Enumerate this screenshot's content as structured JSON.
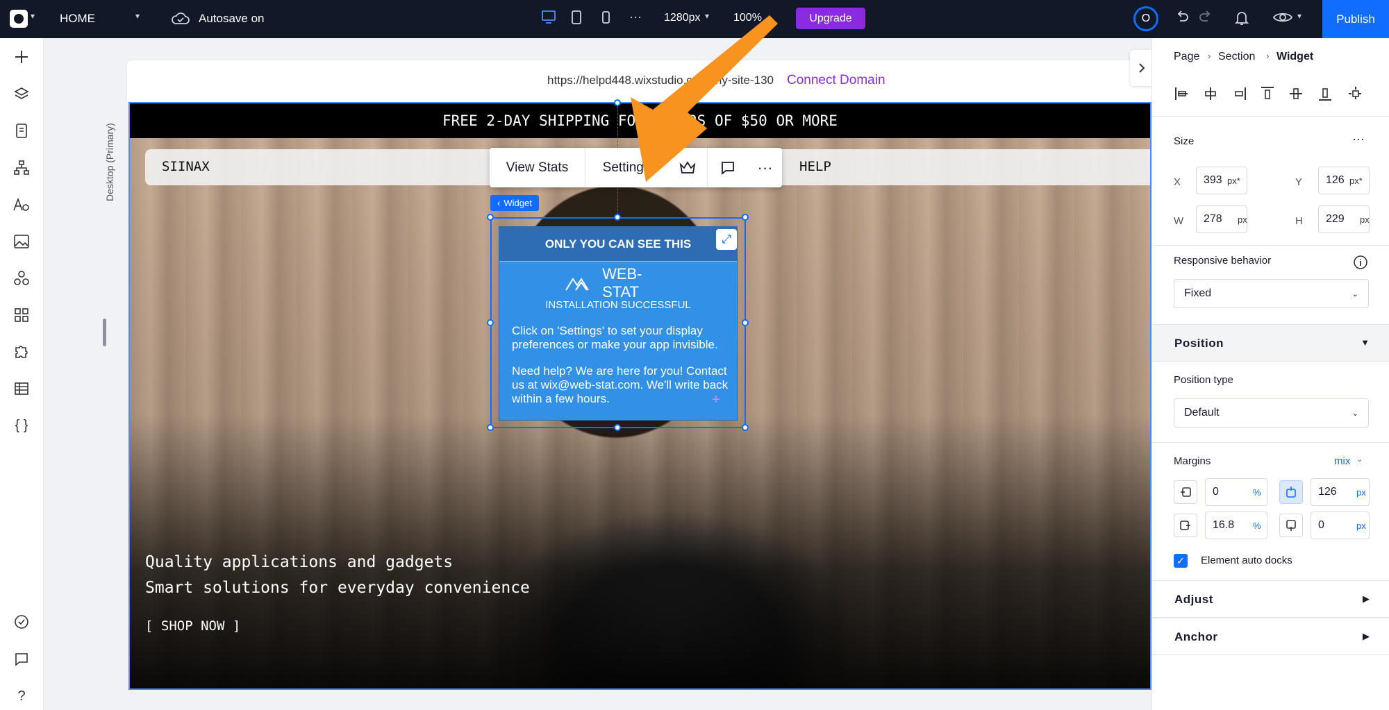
{
  "topbar": {
    "page_name": "HOME",
    "autosave": "Autosave on",
    "width_value": "1280px",
    "zoom": "100%",
    "upgrade": "Upgrade",
    "publish": "Publish",
    "avatar_letter": "O"
  },
  "canvas": {
    "url": "https://helpd448.wixstudio.com/my-site-130",
    "connect_domain": "Connect Domain",
    "breakpoint_label": "Desktop (Primary)"
  },
  "site": {
    "promo": "FREE 2-DAY SHIPPING FOR ORDERS OF $50 OR MORE",
    "brand": "SIINAX",
    "help": "HELP",
    "hero_line1": "Quality applications and gadgets",
    "hero_line2": "Smart solutions for everyday convenience",
    "cta": "[ SHOP NOW ]"
  },
  "context_toolbar": {
    "view_stats": "View Stats",
    "settings": "Settings"
  },
  "widget": {
    "tag": "Widget",
    "header": "ONLY YOU CAN SEE THIS",
    "logo_text": "WEB-STAT",
    "success": "INSTALLATION SUCCESSFUL",
    "para1": "Click on 'Settings' to set your display preferences or make your app invisible.",
    "para2": "Need help? We are here for you! Contact us at wix@web-stat.com. We'll write back within a few hours."
  },
  "inspector": {
    "breadcrumb": {
      "page": "Page",
      "section": "Section",
      "widget": "Widget"
    },
    "size_title": "Size",
    "x_label": "X",
    "x_value": "393",
    "x_unit": "px*",
    "y_label": "Y",
    "y_value": "126",
    "y_unit": "px*",
    "w_label": "W",
    "w_value": "278",
    "w_unit": "px",
    "h_label": "H",
    "h_value": "229",
    "h_unit": "px",
    "responsive_label": "Responsive behavior",
    "responsive_value": "Fixed",
    "position_section": "Position",
    "position_type_label": "Position type",
    "position_type_value": "Default",
    "margins_label": "Margins",
    "margins_mode": "mix",
    "margin_left": "0",
    "margin_left_unit": "%",
    "margin_top": "126",
    "margin_top_unit": "px",
    "margin_right": "16.8",
    "margin_right_unit": "%",
    "margin_bottom": "0",
    "margin_bottom_unit": "px",
    "auto_docks": "Element auto docks",
    "adjust_section": "Adjust",
    "anchor_section": "Anchor"
  },
  "colors": {
    "accent": "#116dff",
    "upgrade": "#8a2be2",
    "topbar": "#111827",
    "arrow": "#f7931e"
  }
}
